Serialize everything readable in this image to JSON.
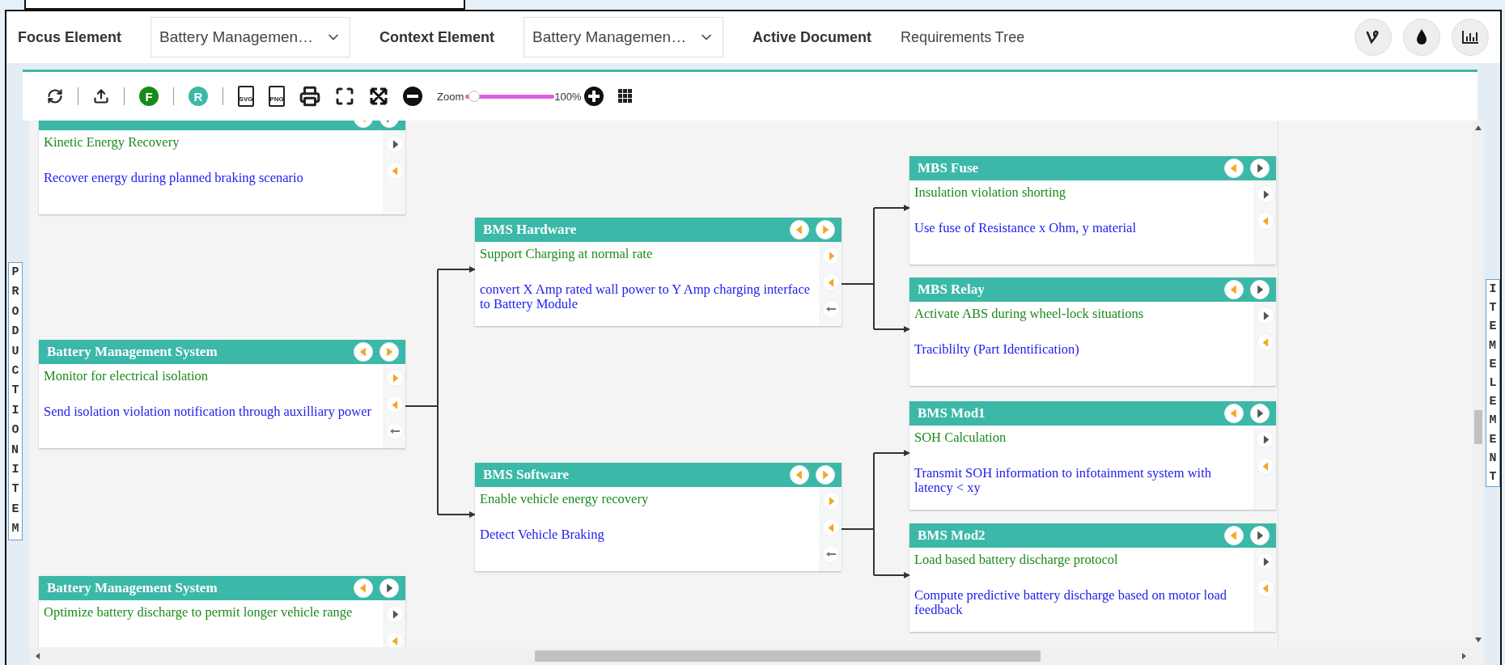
{
  "header": {
    "fields": [
      {
        "kind": "select",
        "label": "Focus Element",
        "value": "Battery Managemen…"
      },
      {
        "kind": "select",
        "label": "Context Element",
        "value": "Battery Managemen…"
      },
      {
        "kind": "text",
        "label": "Active Document",
        "value": "Requirements Tree"
      }
    ]
  },
  "toolbar": {
    "badges": [
      "F",
      "R"
    ],
    "file_labels": [
      "SVG",
      "PNG"
    ],
    "zoom_label": "Zoom",
    "zoom": {
      "level": 0.1
    },
    "zoom_reading": "100%"
  },
  "side_labels": {
    "left": "PRODUCTION ITEM",
    "right": "ITEM ELEMENT"
  },
  "nodes": [
    {
      "requirement": "Kinetic Energy Recovery",
      "description": "Recover energy during planned braking scenario",
      "expanded": false
    },
    {
      "title": "Battery Management System",
      "requirement": "Monitor for electrical isolation",
      "description": "Send isolation violation notification through auxilliary power",
      "expanded": true,
      "children": [
        {
          "title": "BMS Hardware",
          "requirement": "Support Charging at normal rate",
          "description": "convert X Amp rated wall power to Y Amp charging interface to Battery Module",
          "expanded": true,
          "children": [
            {
              "title": "MBS Fuse",
              "requirement": "Insulation violation shorting",
              "description": "Use fuse of Resistance x Ohm, y material",
              "expanded": false
            },
            {
              "title": "MBS Relay",
              "requirement": "Activate ABS during wheel-lock situations",
              "description": "Traciblilty (Part Identification)",
              "expanded": false
            }
          ]
        },
        {
          "title": "BMS Software",
          "requirement": "Enable vehicle energy recovery",
          "description": "Detect Vehicle Braking",
          "expanded": true,
          "children": [
            {
              "title": "BMS Mod1",
              "requirement": "SOH Calculation",
              "description": "Transmit SOH information to infotainment system with latency < xy",
              "expanded": false
            },
            {
              "title": "BMS Mod2",
              "requirement": "Load based battery discharge protocol",
              "description": "Compute predictive battery discharge based on motor load feedback",
              "expanded": false
            }
          ]
        }
      ]
    },
    {
      "title": "Battery Management System",
      "requirement": "Optimize battery discharge to permit longer vehicle range",
      "expanded": false
    }
  ]
}
